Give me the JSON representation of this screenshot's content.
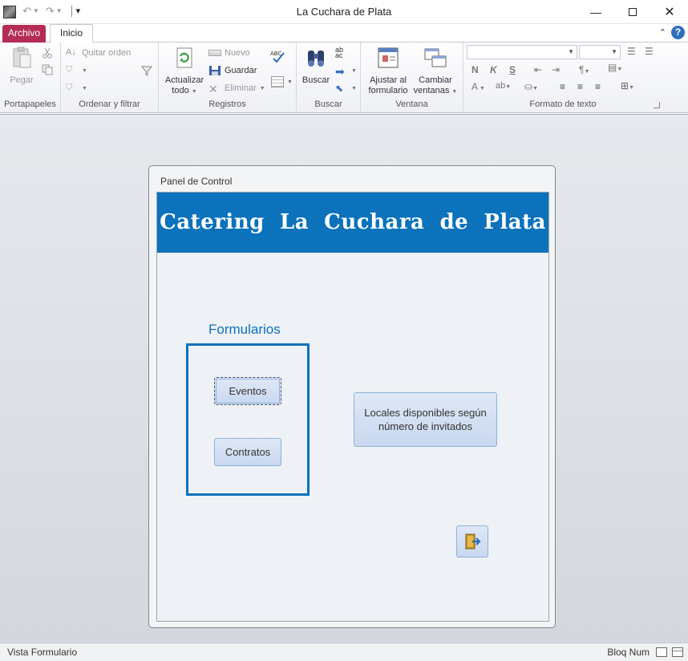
{
  "window": {
    "title": "La Cuchara de Plata",
    "controls": {
      "minimize": "—",
      "maximize": "",
      "close": "✕"
    }
  },
  "quick_access": {
    "undo_icon": "undo-icon",
    "redo_icon": "redo-icon",
    "customize_icon": "customize-icon"
  },
  "tabs": {
    "file": "Archivo",
    "home": "Inicio"
  },
  "ribbon": {
    "groups": {
      "clipboard": "Portapapeles",
      "sort_filter": "Ordenar y filtrar",
      "records": "Registros",
      "find": "Buscar",
      "window": "Ventana",
      "text_format": "Formato de texto"
    },
    "clipboard": {
      "paste": "Pegar"
    },
    "sort_filter": {
      "remove_sort": "Quitar orden"
    },
    "records": {
      "refresh_line1": "Actualizar",
      "refresh_line2": "todo",
      "new": "Nuevo",
      "save": "Guardar",
      "delete": "Eliminar"
    },
    "find": {
      "find": "Buscar"
    },
    "window": {
      "fit_line1": "Ajustar al",
      "fit_line2": "formulario",
      "switch_line1": "Cambiar",
      "switch_line2": "ventanas"
    },
    "text_format": {
      "bold": "N",
      "italic": "K",
      "underline": "S",
      "font_color": "A"
    }
  },
  "form": {
    "window_title": "Panel de Control",
    "header_title": "Catering  La  Cuchara  de  Plata",
    "section_label": "Formularios",
    "buttons": {
      "events": "Eventos",
      "contracts": "Contratos",
      "venues_line1": "Locales disponibles según",
      "venues_line2": "número de invitados"
    },
    "exit_icon": "exit-door-icon"
  },
  "status": {
    "view": "Vista Formulario",
    "num_lock": "Bloq Num"
  }
}
